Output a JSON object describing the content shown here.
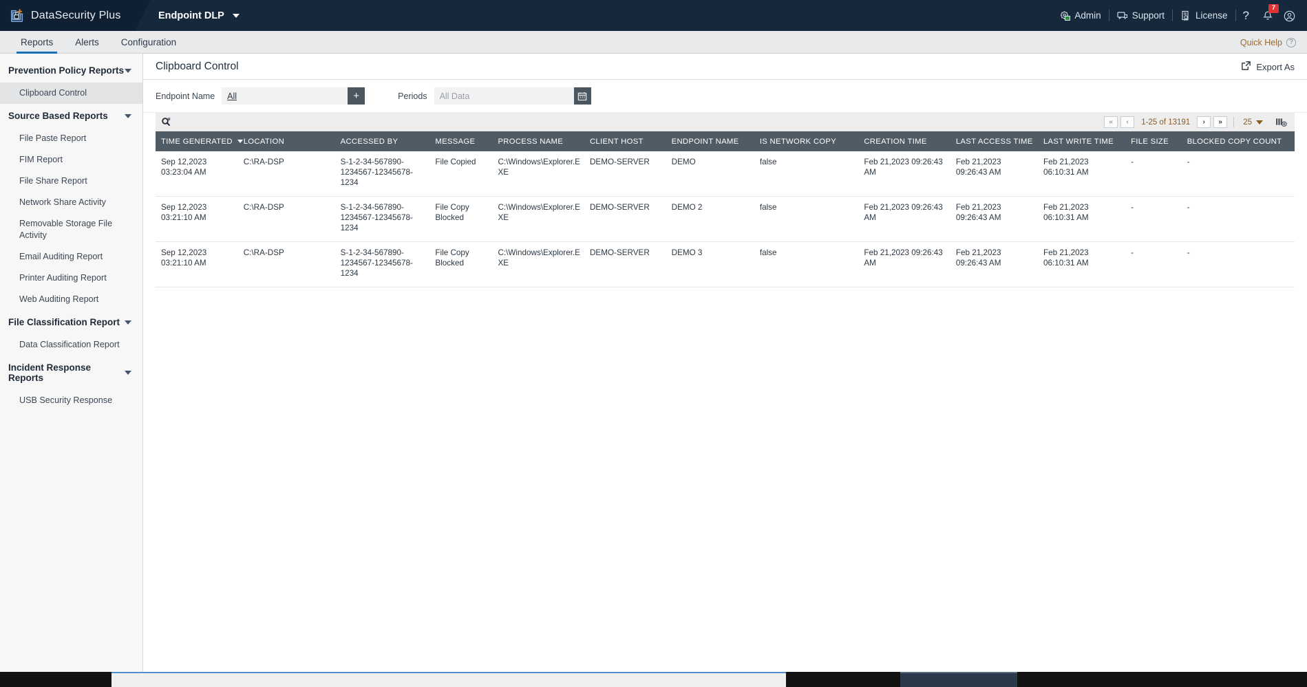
{
  "topbar": {
    "brand": "DataSecurity Plus",
    "brand_icon": "shield-lock-icon",
    "product": "Endpoint DLP",
    "admin": "Admin",
    "support": "Support",
    "license": "License",
    "help_glyph": "?",
    "notification_count": "7",
    "admin_icon": "gear-image-icon",
    "support_icon": "chat-bubble-icon",
    "license_icon": "certificate-icon",
    "bell_icon": "bell-icon",
    "avatar_icon": "user-avatar-icon",
    "accent": "#16283c"
  },
  "nav": {
    "items": [
      {
        "label": "Reports",
        "active": true
      },
      {
        "label": "Alerts",
        "active": false
      },
      {
        "label": "Configuration",
        "active": false
      }
    ],
    "quick_help": "Quick Help",
    "quick_help_glyph": "?",
    "active_color": "#1a6fb5"
  },
  "sidebar": {
    "groups": [
      {
        "label": "Prevention Policy Reports",
        "items": [
          {
            "label": "Clipboard Control",
            "selected": true
          }
        ]
      },
      {
        "label": "Source Based Reports",
        "items": [
          {
            "label": "File Paste Report",
            "selected": false
          },
          {
            "label": "FIM Report",
            "selected": false
          },
          {
            "label": "File Share Report",
            "selected": false
          },
          {
            "label": "Network Share Activity",
            "selected": false
          },
          {
            "label": "Removable Storage File Activity",
            "selected": false
          },
          {
            "label": "Email Auditing Report",
            "selected": false
          },
          {
            "label": "Printer Auditing Report",
            "selected": false
          },
          {
            "label": "Web Auditing Report",
            "selected": false
          }
        ]
      },
      {
        "label": "File Classification Report",
        "items": [
          {
            "label": "Data Classification Report",
            "selected": false
          }
        ]
      },
      {
        "label": "Incident Response Reports",
        "items": [
          {
            "label": "USB Security Response",
            "selected": false
          }
        ]
      }
    ]
  },
  "page": {
    "title": "Clipboard Control",
    "export_label": "Export As",
    "export_icon": "external-link-icon"
  },
  "filters": {
    "endpoint_label": "Endpoint Name",
    "endpoint_value": "All",
    "endpoint_add": "+",
    "periods_label": "Periods",
    "periods_placeholder": "All Data",
    "calendar_icon": "calendar-icon"
  },
  "toolbar": {
    "search_icon": "search-filter-icon",
    "first_glyph": "«",
    "prev_glyph": "‹",
    "next_glyph": "›",
    "last_glyph": "»",
    "range": "1-25 of 13191",
    "page_size": "25",
    "columns_icon": "add-column-icon"
  },
  "table": {
    "columns": [
      {
        "label": "TIME GENERATED",
        "sorted": true
      },
      {
        "label": "LOCATION",
        "sorted": false
      },
      {
        "label": "ACCESSED BY",
        "sorted": false
      },
      {
        "label": "MESSAGE",
        "sorted": false
      },
      {
        "label": "PROCESS NAME",
        "sorted": false
      },
      {
        "label": "CLIENT HOST",
        "sorted": false
      },
      {
        "label": "ENDPOINT NAME",
        "sorted": false
      },
      {
        "label": "IS NETWORK COPY",
        "sorted": false
      },
      {
        "label": "CREATION TIME",
        "sorted": false
      },
      {
        "label": "LAST ACCESS TIME",
        "sorted": false
      },
      {
        "label": "LAST WRITE TIME",
        "sorted": false
      },
      {
        "label": "FILE SIZE",
        "sorted": false
      },
      {
        "label": "BLOCKED COPY COUNT",
        "sorted": false
      }
    ],
    "rows": [
      [
        "Sep 12,2023 03:23:04 AM",
        "C:\\RA-DSP",
        "S-1-2-34-567890-1234567-12345678-1234",
        "File Copied",
        "C:\\Windows\\Explorer.EXE",
        "DEMO-SERVER",
        "DEMO",
        "false",
        "Feb 21,2023 09:26:43 AM",
        "Feb 21,2023 09:26:43 AM",
        "Feb 21,2023 06:10:31 AM",
        "-",
        "-"
      ],
      [
        "Sep 12,2023 03:21:10 AM",
        "C:\\RA-DSP",
        "S-1-2-34-567890-1234567-12345678-1234",
        "File Copy Blocked",
        "C:\\Windows\\Explorer.EXE",
        "DEMO-SERVER",
        "DEMO 2",
        "false",
        "Feb 21,2023 09:26:43 AM",
        "Feb 21,2023 09:26:43 AM",
        "Feb 21,2023 06:10:31 AM",
        "-",
        "-"
      ],
      [
        "Sep 12,2023 03:21:10 AM",
        "C:\\RA-DSP",
        "S-1-2-34-567890-1234567-12345678-1234",
        "File Copy Blocked",
        "C:\\Windows\\Explorer.EXE",
        "DEMO-SERVER",
        "DEMO 3",
        "false",
        "Feb 21,2023 09:26:43 AM",
        "Feb 21,2023 09:26:43 AM",
        "Feb 21,2023 06:10:31 AM",
        "-",
        "-"
      ]
    ]
  }
}
